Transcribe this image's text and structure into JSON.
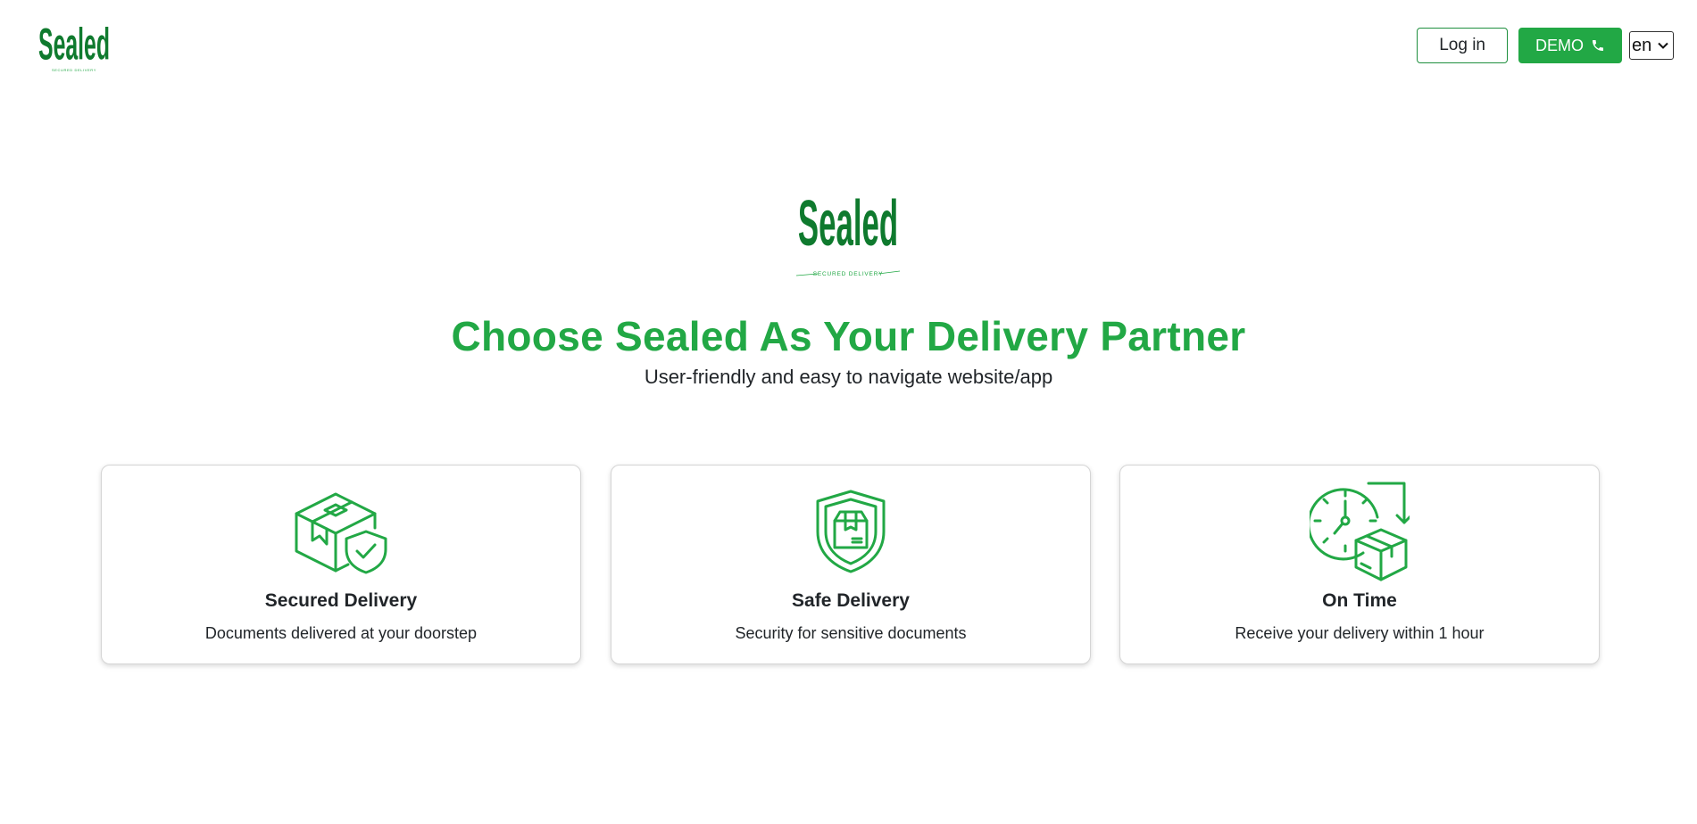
{
  "nav": {
    "logo_text": "Sealed",
    "logo_tagline": "SECURED DELIVERY",
    "login_label": "Log in",
    "demo_label": "DEMO",
    "language": "en"
  },
  "hero": {
    "logo_text": "Sealed",
    "logo_tagline": "SECURED DELIVERY",
    "title": "Choose Sealed As Your Delivery Partner",
    "subtitle": "User-friendly and easy to navigate website/app"
  },
  "features": [
    {
      "icon": "box-shield-check-icon",
      "title": "Secured Delivery",
      "text": "Documents delivered at your doorstep"
    },
    {
      "icon": "shield-box-icon",
      "title": "Safe Delivery",
      "text": "Security for sensitive documents"
    },
    {
      "icon": "clock-box-icon",
      "title": "On Time",
      "text": "Receive your delivery within 1 hour"
    }
  ],
  "colors": {
    "brand_green": "#22a845",
    "logo_dark_green": "#0f7a2e"
  }
}
